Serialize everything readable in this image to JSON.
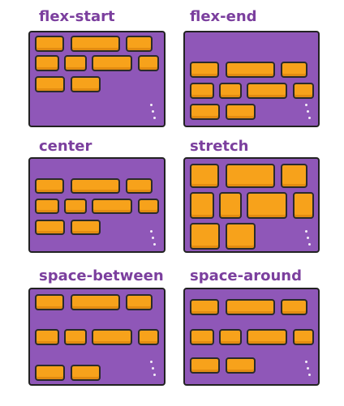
{
  "colors": {
    "container": "#8f57b8",
    "item": "#f7a21b",
    "title": "#7b3f9e",
    "outline": "#222222"
  },
  "panels": [
    {
      "title": "flex-start",
      "value": "flex-start"
    },
    {
      "title": "flex-end",
      "value": "flex-end"
    },
    {
      "title": "center",
      "value": "center"
    },
    {
      "title": "stretch",
      "value": "stretch"
    },
    {
      "title": "space-between",
      "value": "space-between"
    },
    {
      "title": "space-around",
      "value": "space-around"
    }
  ]
}
